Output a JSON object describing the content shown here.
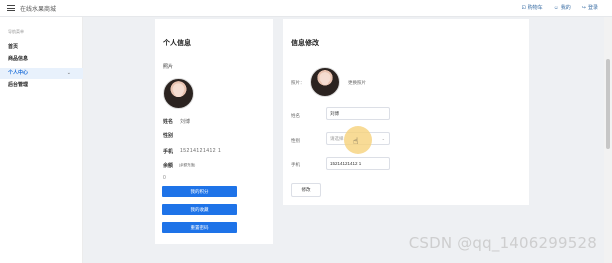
{
  "header": {
    "title": "在线水果商城",
    "actions": [
      {
        "icon": "cart-icon",
        "label": "购物车"
      },
      {
        "icon": "user-icon",
        "label": "我的"
      },
      {
        "icon": "logout-icon",
        "label": "登录"
      }
    ]
  },
  "sidebar": {
    "heading": "导航菜单",
    "items": [
      {
        "label": "首页"
      },
      {
        "label": "商品信息"
      },
      {
        "label": "个人中心",
        "active": true,
        "expand_icon": "chevron-down-icon"
      },
      {
        "label": "后台管理"
      }
    ]
  },
  "profile": {
    "title": "个人信息",
    "photo_label": "照片",
    "name_label": "姓名",
    "name_value": "刘博",
    "gender_label": "性别",
    "phone_label": "手机",
    "phone_value": "15214121412 1",
    "balance_label": "余额",
    "balance_note": "(余额充值)",
    "balance_value": "0",
    "buttons": [
      "我的积分",
      "我的收藏",
      "重置密码"
    ]
  },
  "edit_form": {
    "title": "信息修改",
    "photo_label": "照片：",
    "upload_label": "更换照片",
    "name_label": "姓名",
    "name_value": "刘博",
    "gender_label": "性别",
    "gender_placeholder": "请选择",
    "phone_label": "手机",
    "phone_value": "15214121412 1",
    "submit_label": "修改"
  },
  "watermark": "CSDN @qq_1406299528",
  "colors": {
    "accent": "#1e73e8",
    "highlight": "#f6d27c",
    "sidebar_active_bg": "#e8f1fc"
  }
}
